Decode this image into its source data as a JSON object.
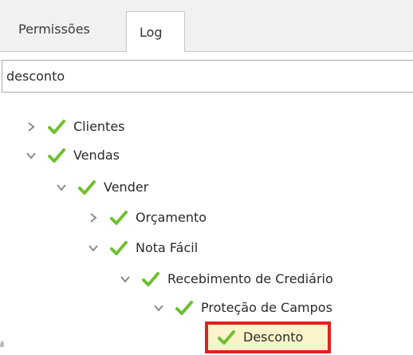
{
  "tabs": {
    "permissoes": "Permissões",
    "log": "Log",
    "active": "log"
  },
  "search": {
    "value": "desconto"
  },
  "tree": {
    "nodes": [
      {
        "label": "Clientes",
        "level": 0,
        "expanded": false,
        "checked": true
      },
      {
        "label": "Vendas",
        "level": 0,
        "expanded": true,
        "checked": true
      },
      {
        "label": "Vender",
        "level": 1,
        "expanded": true,
        "checked": true
      },
      {
        "label": "Orçamento",
        "level": 2,
        "expanded": false,
        "checked": true
      },
      {
        "label": "Nota Fácil",
        "level": 2,
        "expanded": true,
        "checked": true
      },
      {
        "label": "Recebimento de Crediário",
        "level": 3,
        "expanded": true,
        "checked": true
      },
      {
        "label": "Proteção de Campos",
        "level": 4,
        "expanded": true,
        "checked": true
      },
      {
        "label": "Desconto",
        "level": 5,
        "expanded": null,
        "checked": true,
        "highlighted": true
      }
    ]
  },
  "footer_fragment": "il",
  "colors": {
    "check_green": "#6fbf2f",
    "highlight_border": "#e02020",
    "highlight_fill": "#fbf3c9"
  }
}
